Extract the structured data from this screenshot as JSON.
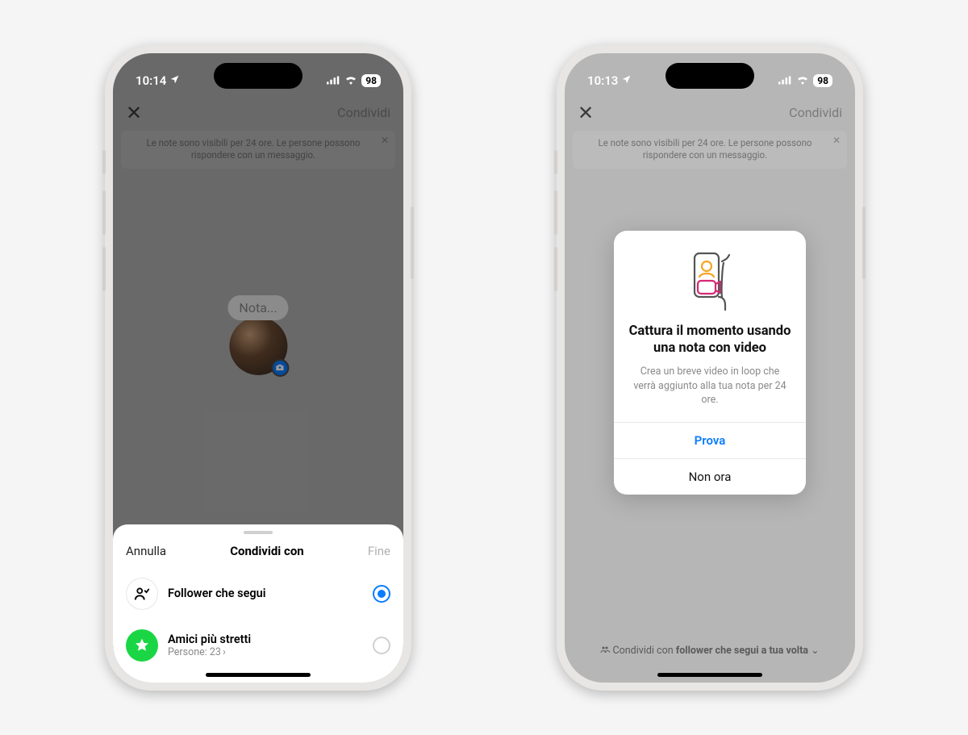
{
  "left": {
    "status": {
      "time": "10:14",
      "battery": "98"
    },
    "nav": {
      "share_label": "Condividi"
    },
    "banner_text": "Le note sono visibili per 24 ore. Le persone possono rispondere con un messaggio.",
    "note_placeholder": "Nota...",
    "sheet": {
      "cancel": "Annulla",
      "title": "Condividi con",
      "done": "Fine",
      "option_followers": "Follower che segui",
      "option_close_friends": "Amici più stretti",
      "close_friends_count_label": "Persone: 23"
    }
  },
  "right": {
    "status": {
      "time": "10:13",
      "battery": "98"
    },
    "nav": {
      "share_label": "Condividi"
    },
    "banner_text": "Le note sono visibili per 24 ore. Le persone possono rispondere con un messaggio.",
    "modal": {
      "title": "Cattura il momento usando una nota con video",
      "desc": "Crea un breve video in loop che verrà aggiunto alla tua nota per 24 ore.",
      "primary": "Prova",
      "secondary": "Non ora"
    },
    "footer_prefix": "Condividi con ",
    "footer_bold": "follower che segui a tua volta"
  }
}
